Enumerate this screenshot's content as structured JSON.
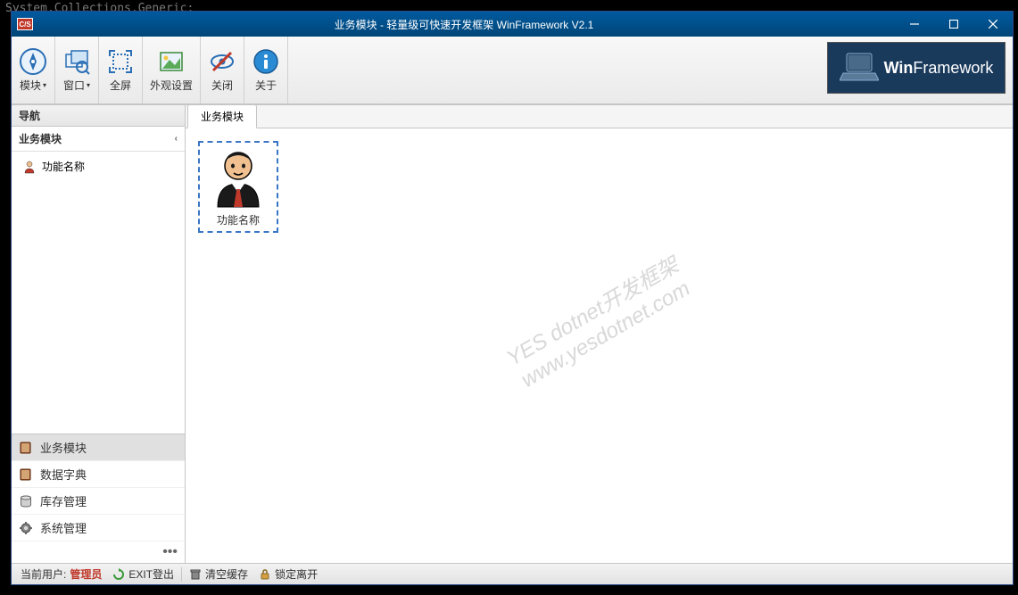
{
  "background_code": "System.Collections.Generic;",
  "window": {
    "title": "业务模块 - 轻量级可快速开发框架 WinFramework V2.1",
    "app_icon_text": "C/S"
  },
  "ribbon": {
    "module": "模块",
    "window": "窗口",
    "fullscreen": "全屏",
    "appearance": "外观设置",
    "close": "关闭",
    "about": "关于"
  },
  "logo": {
    "prefix": "Win",
    "suffix": "Framework"
  },
  "nav": {
    "header": "导航",
    "section": "业务模块",
    "tree_item": "功能名称",
    "categories": [
      {
        "label": "业务模块",
        "icon": "book",
        "active": true
      },
      {
        "label": "数据字典",
        "icon": "book",
        "active": false
      },
      {
        "label": "库存管理",
        "icon": "db",
        "active": false
      },
      {
        "label": "系统管理",
        "icon": "gear",
        "active": false
      }
    ]
  },
  "tab": {
    "label": "业务模块"
  },
  "module_card": {
    "label": "功能名称"
  },
  "watermark": {
    "line1": "YES dotnet开发框架",
    "line2": "www.yesdotnet.com"
  },
  "status": {
    "current_user_label": "当前用户:",
    "current_user_value": "管理员",
    "exit_login": "EXIT登出",
    "clear_cache": "清空缓存",
    "lock_leave": "锁定离开"
  }
}
